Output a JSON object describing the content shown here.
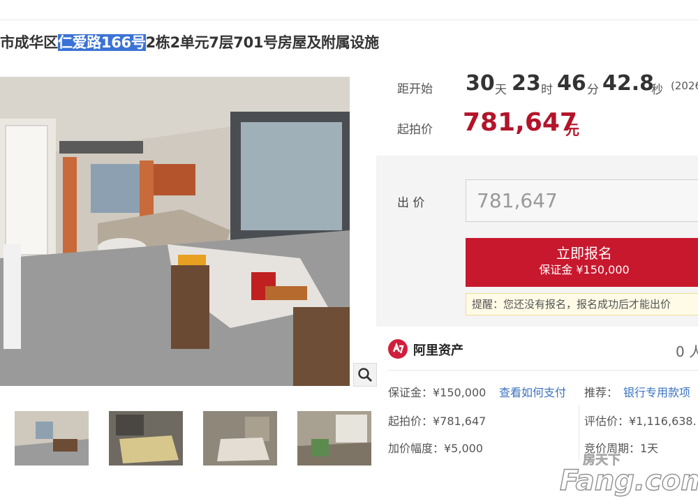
{
  "title": {
    "prefix": "市成华区",
    "highlight": "仁爱路166号",
    "suffix": "2栋2单元7层701号房屋及附属设施"
  },
  "countdown": {
    "label": "距开始",
    "days": "30",
    "days_unit": "天",
    "hours": "23",
    "hours_unit": "时",
    "minutes": "46",
    "minutes_unit": "分",
    "seconds": "42.8",
    "seconds_unit": "秒",
    "date_fragment": "(2026"
  },
  "start_price": {
    "label": "起拍价",
    "value": "781,647",
    "unit": "元"
  },
  "bid": {
    "label": "出 价",
    "input_value": "781,647",
    "button_label": "立即报名",
    "button_sub": "保证金 ¥150,000",
    "notice": "提醒：您还没有报名，报名成功后才能出价"
  },
  "seller": {
    "name": "阿里资产",
    "count": "0 人"
  },
  "info": {
    "deposit": "保证金：¥150,000",
    "how_to_pay": "查看如何支付",
    "recommend_label": "推荐：",
    "recommend_link": "银行专用款项",
    "start_price": "起拍价：¥781,647",
    "appraisal": "评估价：¥1,116,638.",
    "increment": "加价幅度：¥5,000",
    "cycle": "竞价周期：1天"
  },
  "watermark": {
    "cn": "房天下",
    "en": "Fang.com"
  },
  "colors": {
    "accent_red": "#c8182e",
    "price_red": "#b3142a",
    "link_blue": "#3b73c0",
    "highlight_blue": "#3b73d4"
  },
  "icons": [
    "zoom-icon",
    "ali-assets-logo"
  ]
}
